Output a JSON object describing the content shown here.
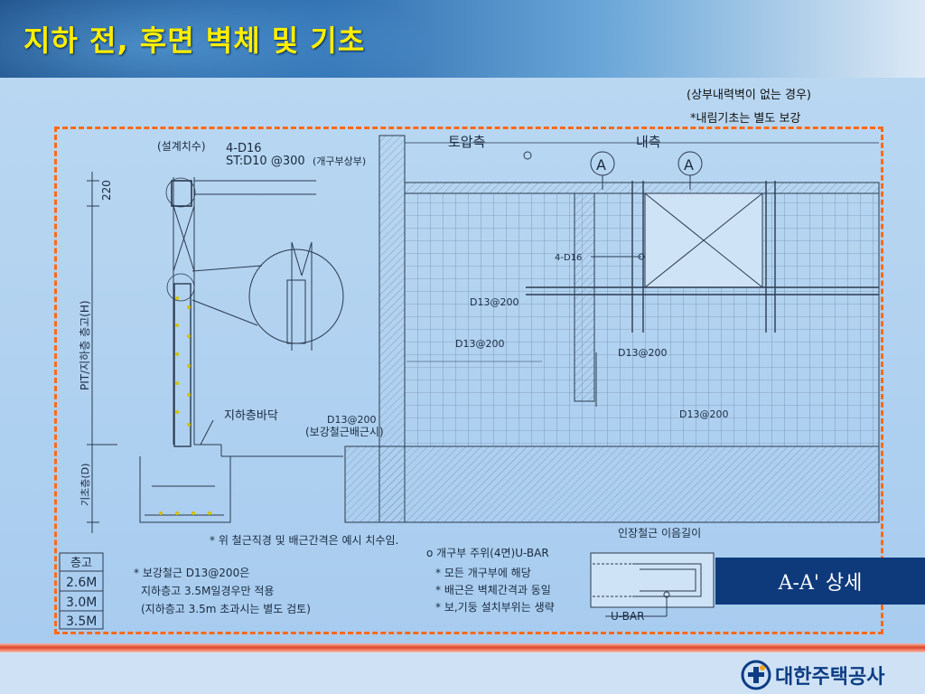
{
  "header": {
    "title": "지하 전, 후면 벽체 및 기초"
  },
  "notes": {
    "top_condition": "(상부내력벽이 없는 경우)",
    "top_instruction": "*내림기초는 별도 보강"
  },
  "section": {
    "circle_label": "(설계치수)",
    "bar_main": "4-D16",
    "stirrup": "ST:D10 @300",
    "stirrup_note": "(개구부상부)",
    "dim_top": "220",
    "dim_story": "PIT/지하층 층고(H)",
    "floor_label": "지하층바닥",
    "dim_footing": "기초층(D)"
  },
  "elevation": {
    "soil_side": "토압측",
    "inner_side": "내측",
    "mark_a1": "A",
    "mark_a2": "A",
    "bar_4d16": "4-D16",
    "bar_a": "D13@200",
    "bar_b": "D13@200",
    "bar_c": "D13@200",
    "bar_d": "D13@200",
    "bar_e": "D13@200",
    "reinforce_label": "(보강철근배근시)"
  },
  "footnote": "* 위 철근직경 및 배근간격은 예시 치수임.",
  "table": {
    "header": "층고",
    "rows": [
      "2.6M",
      "3.0M",
      "3.5M"
    ]
  },
  "left_notes": {
    "line1": "* 보강철근 D13@200은",
    "line2": "지하층고 3.5M일경우만 적용",
    "line3": "(지하층고 3.5m 초과시는 별도 검토)"
  },
  "opening_notes": {
    "title": "o 개구부 주위(4면)U-BAR",
    "line1": "* 모든 개구부에 해당",
    "line2": "* 배근은 벽체간격과 동일",
    "line3": "* 보,기둥 설치부위는 생략"
  },
  "detail": {
    "lap_label": "인장철근 이음길이",
    "ubar_label": "U-BAR"
  },
  "aa_title": "A-A' 상세",
  "logo": {
    "text": "대한주택공사"
  },
  "colors": {
    "title": "#ffee00",
    "frame": "#ff6a1a",
    "aa_box": "#0e3a7c"
  }
}
